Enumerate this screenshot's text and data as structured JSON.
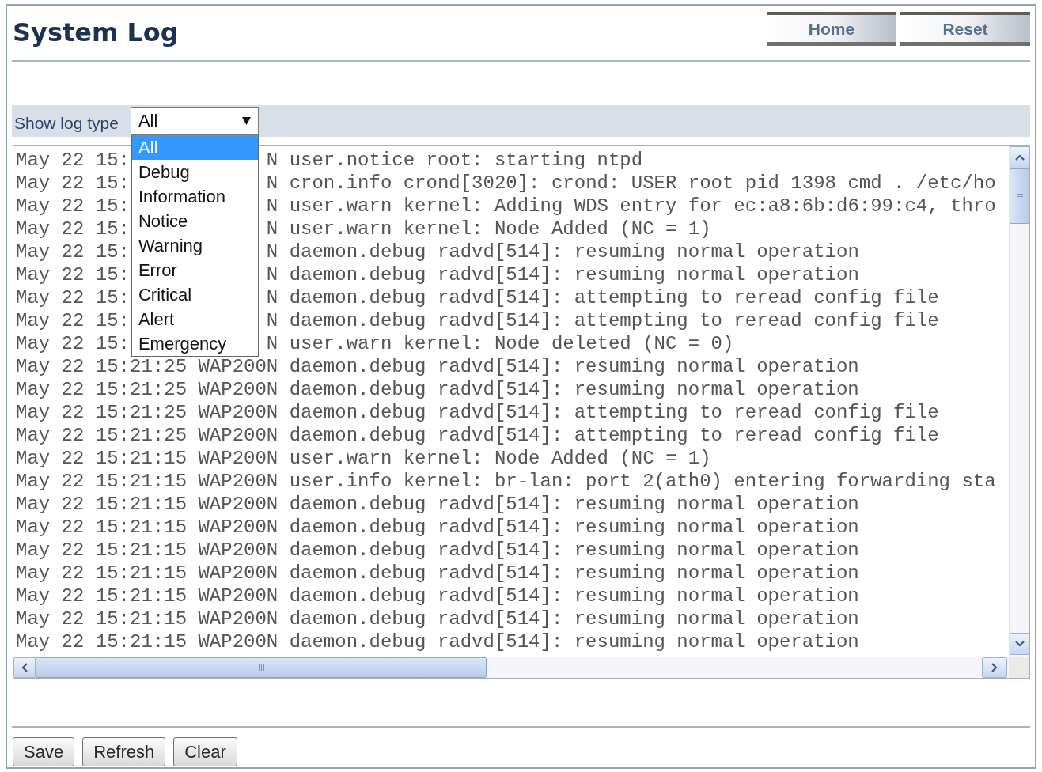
{
  "page": {
    "title": "System Log"
  },
  "header_buttons": [
    "Home",
    "Reset"
  ],
  "log_type": {
    "label": "Show log type",
    "value": "All",
    "options": [
      {
        "label": "All",
        "selected": true
      },
      {
        "label": "Debug",
        "selected": false
      },
      {
        "label": "Information",
        "selected": false
      },
      {
        "label": "Notice",
        "selected": false
      },
      {
        "label": "Warning",
        "selected": false
      },
      {
        "label": "Error",
        "selected": false
      },
      {
        "label": "Critical",
        "selected": false
      },
      {
        "label": "Alert",
        "selected": false
      },
      {
        "label": "Emergency",
        "selected": false
      }
    ]
  },
  "log": {
    "lines": [
      {
        "parts": [
          "May 22 15:",
          "N user.notice root: starting ntpd"
        ]
      },
      {
        "parts": [
          "May 22 15:",
          "N cron.info crond[3020]: crond: USER root pid 1398 cmd . /etc/ho"
        ]
      },
      {
        "parts": [
          "May 22 15:",
          "N user.warn kernel: Adding WDS entry for ec:a8:6b:d6:99:c4, thro"
        ]
      },
      {
        "parts": [
          "May 22 15:",
          "N user.warn kernel: Node Added (NC = 1)"
        ]
      },
      {
        "parts": [
          "May 22 15:",
          "N daemon.debug radvd[514]: resuming normal operation"
        ]
      },
      {
        "parts": [
          "May 22 15:",
          "N daemon.debug radvd[514]: resuming normal operation"
        ]
      },
      {
        "parts": [
          "May 22 15:",
          "N daemon.debug radvd[514]: attempting to reread config file"
        ]
      },
      {
        "parts": [
          "May 22 15:",
          "N daemon.debug radvd[514]: attempting to reread config file"
        ]
      },
      {
        "parts": [
          "May 22 15:",
          "N user.warn kernel: Node deleted (NC = 0)"
        ]
      },
      {
        "parts": [
          "May 22 15:21:25 WAP200N daemon.debug radvd[514]: resuming normal operation"
        ]
      },
      {
        "parts": [
          "May 22 15:21:25 WAP200N daemon.debug radvd[514]: resuming normal operation"
        ]
      },
      {
        "parts": [
          "May 22 15:21:25 WAP200N daemon.debug radvd[514]: attempting to reread config file"
        ]
      },
      {
        "parts": [
          "May 22 15:21:25 WAP200N daemon.debug radvd[514]: attempting to reread config file"
        ]
      },
      {
        "parts": [
          "May 22 15:21:15 WAP200N user.warn kernel: Node Added (NC = 1)"
        ]
      },
      {
        "parts": [
          "May 22 15:21:15 WAP200N user.info kernel: br-lan: port 2(ath0) entering forwarding sta"
        ]
      },
      {
        "parts": [
          "May 22 15:21:15 WAP200N daemon.debug radvd[514]: resuming normal operation"
        ]
      },
      {
        "parts": [
          "May 22 15:21:15 WAP200N daemon.debug radvd[514]: resuming normal operation"
        ]
      },
      {
        "parts": [
          "May 22 15:21:15 WAP200N daemon.debug radvd[514]: resuming normal operation"
        ]
      },
      {
        "parts": [
          "May 22 15:21:15 WAP200N daemon.debug radvd[514]: resuming normal operation"
        ]
      },
      {
        "parts": [
          "May 22 15:21:15 WAP200N daemon.debug radvd[514]: resuming normal operation"
        ]
      },
      {
        "parts": [
          "May 22 15:21:15 WAP200N daemon.debug radvd[514]: resuming normal operation"
        ]
      },
      {
        "parts": [
          "May 22 15:21:15 WAP200N daemon.debug radvd[514]: resuming normal operation"
        ]
      }
    ]
  },
  "footer_buttons": [
    "Save",
    "Refresh",
    "Clear"
  ]
}
